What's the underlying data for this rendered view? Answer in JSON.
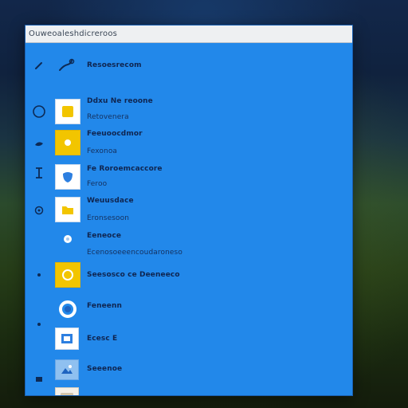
{
  "window": {
    "title": "Ouweoaleshdicreroos"
  },
  "rows": [
    {
      "icon": "pen-icon",
      "thumb": "wrench-icon",
      "line1": "Resoesrecom",
      "line2": ""
    },
    {
      "icon": "circle-icon",
      "thumb": "note-icon",
      "line1": "Ddxu Ne reoone",
      "line2": "Retovenera"
    },
    {
      "icon": "lock-icon",
      "thumb": "sun-icon",
      "line1": "Feeuoocdmor",
      "line2": "Fexonoa"
    },
    {
      "icon": "pin-icon",
      "thumb": "shield-icon",
      "line1": "Fe Roroemcaccore",
      "line2": "Feroo"
    },
    {
      "icon": "gear-icon",
      "thumb": "folder-icon",
      "line1": "Weuusdace",
      "line2": "Eronsesoon"
    },
    {
      "icon": "",
      "thumb": "dot-icon",
      "line1": "Eeneoce",
      "line2": "Ecenosoeeencoudaroneso"
    },
    {
      "icon": "dot-icon",
      "thumb": "badge-icon",
      "line1": "Seesosco ce Deeneeco",
      "line2": ""
    },
    {
      "icon": "",
      "thumb": "ring-icon",
      "line1": "Feneenn",
      "line2": ""
    },
    {
      "icon": "dot-icon",
      "thumb": "app-icon",
      "line1": "Ecesc E",
      "line2": ""
    },
    {
      "icon": "square-icon",
      "thumb": "image-icon",
      "line1": "Seeenoe",
      "line2": ""
    },
    {
      "icon": "",
      "thumb": "window-icon",
      "line1": "",
      "line2": ""
    }
  ],
  "colors": {
    "panel": "#2288ea",
    "accent_yellow": "#f2c500",
    "text": "#0f2550"
  }
}
